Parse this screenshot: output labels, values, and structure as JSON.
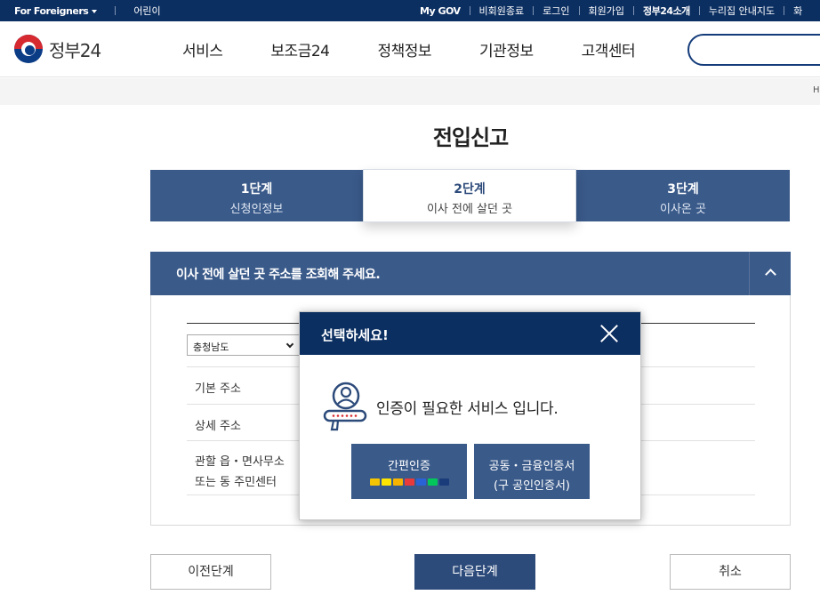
{
  "topbar": {
    "foreigners": "For Foreigners",
    "kids": "어린이",
    "links": [
      "My GOV",
      "비회원종료",
      "로그인",
      "회원가입",
      "정부24소개",
      "누리집 안내지도",
      "화"
    ]
  },
  "header": {
    "logo_text": "정부24",
    "nav": [
      "서비스",
      "보조금24",
      "정책정보",
      "기관정보",
      "고객센터"
    ],
    "search_placeholder": ""
  },
  "breadcrumb": {
    "text": "H"
  },
  "page": {
    "title": "전입신고"
  },
  "steps": [
    {
      "num": "1단계",
      "desc": "신청인정보"
    },
    {
      "num": "2단계",
      "desc": "이사 전에 살던 곳"
    },
    {
      "num": "3단계",
      "desc": "이사온 곳"
    }
  ],
  "panel": {
    "title": "이사 전에 살던 곳 주소를 조회해 주세요.",
    "province": "충청남도",
    "rows": [
      "기본 주소",
      "상세 주소",
      "관할 읍・면사무소\n또는 동 주민센터"
    ]
  },
  "buttons": {
    "prev": "이전단계",
    "next": "다음단계",
    "cancel": "취소"
  },
  "modal": {
    "title": "선택하세요!",
    "message": "인증이 필요한 서비스 입니다.",
    "easy_label": "간편인증",
    "cert_line1": "공동・금융인증서",
    "cert_line2": "(구 공인인증서)",
    "badge_colors": [
      "#f4c400",
      "#ffe400",
      "#f6b400",
      "#e83a3a",
      "#2a63d6",
      "#03c75a",
      "#1b3c7a"
    ]
  },
  "colors": {
    "navy": "#0c2f62",
    "step_blue": "#3a5a8a",
    "accent": "#2c4a7a"
  }
}
